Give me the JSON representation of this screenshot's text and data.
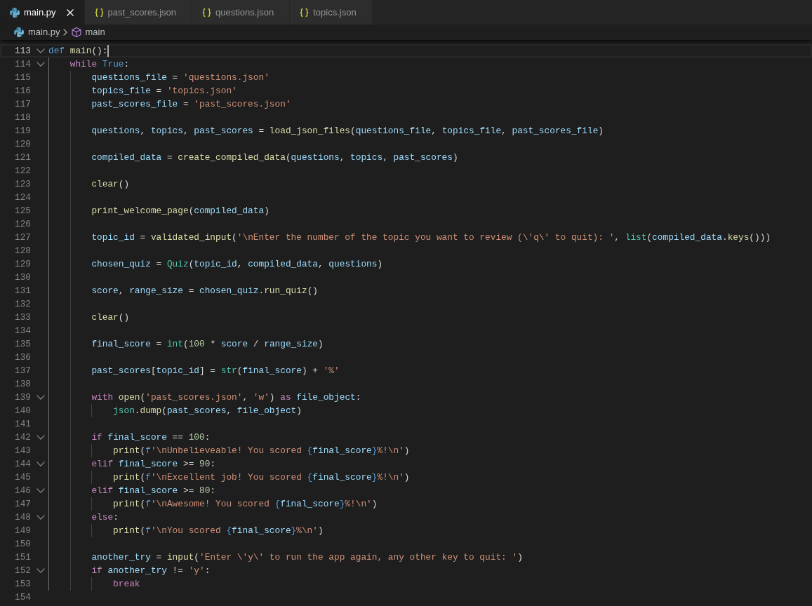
{
  "tabs": [
    {
      "label": "main.py",
      "kind": "python",
      "selected": true
    },
    {
      "label": "past_scores.json",
      "kind": "json",
      "selected": false
    },
    {
      "label": "questions.json",
      "kind": "json",
      "selected": false
    },
    {
      "label": "topics.json",
      "kind": "json",
      "selected": false
    }
  ],
  "breadcrumbs": [
    {
      "label": "main.py",
      "kind": "python"
    },
    {
      "label": "main",
      "kind": "method"
    }
  ],
  "editor": {
    "lines": [
      {
        "number": "113",
        "foldable": true,
        "active": true,
        "tokens": [
          {
            "text": "def ",
            "kind": "keyword"
          },
          {
            "text": "main",
            "kind": "function"
          },
          {
            "text": "():",
            "kind": "plain"
          }
        ]
      },
      {
        "number": "114",
        "foldable": true,
        "active": false,
        "tokens": [
          {
            "text": "    while ",
            "kind": "control"
          },
          {
            "text": "True",
            "kind": "keyword"
          },
          {
            "text": ":",
            "kind": "plain"
          }
        ]
      },
      {
        "number": "115",
        "foldable": false,
        "active": false,
        "tokens": [
          {
            "text": "        questions_file",
            "kind": "variable"
          },
          {
            "text": " = ",
            "kind": "plain"
          },
          {
            "text": "'questions.json'",
            "kind": "string"
          }
        ]
      },
      {
        "number": "116",
        "foldable": false,
        "active": false,
        "tokens": [
          {
            "text": "        topics_file",
            "kind": "variable"
          },
          {
            "text": " = ",
            "kind": "plain"
          },
          {
            "text": "'topics.json'",
            "kind": "string"
          }
        ]
      },
      {
        "number": "117",
        "foldable": false,
        "active": false,
        "tokens": [
          {
            "text": "        past_scores_file",
            "kind": "variable"
          },
          {
            "text": " = ",
            "kind": "plain"
          },
          {
            "text": "'past_scores.json'",
            "kind": "string"
          }
        ]
      },
      {
        "number": "118",
        "foldable": false,
        "active": false
      },
      {
        "number": "119",
        "foldable": false,
        "active": false,
        "tokens": [
          {
            "text": "        questions",
            "kind": "variable"
          },
          {
            "text": ", ",
            "kind": "plain"
          },
          {
            "text": "topics",
            "kind": "variable"
          },
          {
            "text": ", ",
            "kind": "plain"
          },
          {
            "text": "past_scores",
            "kind": "variable"
          },
          {
            "text": " = ",
            "kind": "plain"
          },
          {
            "text": "load_json_files",
            "kind": "function"
          },
          {
            "text": "(",
            "kind": "plain"
          },
          {
            "text": "questions_file",
            "kind": "variable"
          },
          {
            "text": ", ",
            "kind": "plain"
          },
          {
            "text": "topics_file",
            "kind": "variable"
          },
          {
            "text": ", ",
            "kind": "plain"
          },
          {
            "text": "past_scores_file",
            "kind": "variable"
          },
          {
            "text": ")",
            "kind": "plain"
          }
        ]
      },
      {
        "number": "120",
        "foldable": false,
        "active": false
      },
      {
        "number": "121",
        "foldable": false,
        "active": false,
        "tokens": [
          {
            "text": "        compiled_data",
            "kind": "variable"
          },
          {
            "text": " = ",
            "kind": "plain"
          },
          {
            "text": "create_compiled_data",
            "kind": "function"
          },
          {
            "text": "(",
            "kind": "plain"
          },
          {
            "text": "questions",
            "kind": "variable"
          },
          {
            "text": ", ",
            "kind": "plain"
          },
          {
            "text": "topics",
            "kind": "variable"
          },
          {
            "text": ", ",
            "kind": "plain"
          },
          {
            "text": "past_scores",
            "kind": "variable"
          },
          {
            "text": ")",
            "kind": "plain"
          }
        ]
      },
      {
        "number": "122",
        "foldable": false,
        "active": false
      },
      {
        "number": "123",
        "foldable": false,
        "active": false,
        "tokens": [
          {
            "text": "        clear",
            "kind": "function"
          },
          {
            "text": "()",
            "kind": "plain"
          }
        ]
      },
      {
        "number": "124",
        "foldable": false,
        "active": false
      },
      {
        "number": "125",
        "foldable": false,
        "active": false,
        "tokens": [
          {
            "text": "        print_welcome_page",
            "kind": "function"
          },
          {
            "text": "(",
            "kind": "plain"
          },
          {
            "text": "compiled_data",
            "kind": "variable"
          },
          {
            "text": ")",
            "kind": "plain"
          }
        ]
      },
      {
        "number": "126",
        "foldable": false,
        "active": false
      },
      {
        "number": "127",
        "foldable": false,
        "active": false,
        "tokens": [
          {
            "text": "        topic_id",
            "kind": "variable"
          },
          {
            "text": " = ",
            "kind": "plain"
          },
          {
            "text": "validated_input",
            "kind": "function"
          },
          {
            "text": "(",
            "kind": "plain"
          },
          {
            "text": "'\\nEnter the number of the topic you want to review (\\'q\\' to quit): '",
            "kind": "string"
          },
          {
            "text": ", ",
            "kind": "plain"
          },
          {
            "text": "list",
            "kind": "type"
          },
          {
            "text": "(",
            "kind": "plain"
          },
          {
            "text": "compiled_data",
            "kind": "variable"
          },
          {
            "text": ".",
            "kind": "plain"
          },
          {
            "text": "keys",
            "kind": "function"
          },
          {
            "text": "()))",
            "kind": "plain"
          }
        ]
      },
      {
        "number": "128",
        "foldable": false,
        "active": false
      },
      {
        "number": "129",
        "foldable": false,
        "active": false,
        "tokens": [
          {
            "text": "        chosen_quiz",
            "kind": "variable"
          },
          {
            "text": " = ",
            "kind": "plain"
          },
          {
            "text": "Quiz",
            "kind": "type"
          },
          {
            "text": "(",
            "kind": "plain"
          },
          {
            "text": "topic_id",
            "kind": "variable"
          },
          {
            "text": ", ",
            "kind": "plain"
          },
          {
            "text": "compiled_data",
            "kind": "variable"
          },
          {
            "text": ", ",
            "kind": "plain"
          },
          {
            "text": "questions",
            "kind": "variable"
          },
          {
            "text": ")",
            "kind": "plain"
          }
        ]
      },
      {
        "number": "130",
        "foldable": false,
        "active": false
      },
      {
        "number": "131",
        "foldable": false,
        "active": false,
        "tokens": [
          {
            "text": "        score",
            "kind": "variable"
          },
          {
            "text": ", ",
            "kind": "plain"
          },
          {
            "text": "range_size",
            "kind": "variable"
          },
          {
            "text": " = ",
            "kind": "plain"
          },
          {
            "text": "chosen_quiz",
            "kind": "variable"
          },
          {
            "text": ".",
            "kind": "plain"
          },
          {
            "text": "run_quiz",
            "kind": "function"
          },
          {
            "text": "()",
            "kind": "plain"
          }
        ]
      },
      {
        "number": "132",
        "foldable": false,
        "active": false
      },
      {
        "number": "133",
        "foldable": false,
        "active": false,
        "tokens": [
          {
            "text": "        clear",
            "kind": "function"
          },
          {
            "text": "()",
            "kind": "plain"
          }
        ]
      },
      {
        "number": "134",
        "foldable": false,
        "active": false
      },
      {
        "number": "135",
        "foldable": false,
        "active": false,
        "tokens": [
          {
            "text": "        final_score",
            "kind": "variable"
          },
          {
            "text": " = ",
            "kind": "plain"
          },
          {
            "text": "int",
            "kind": "type"
          },
          {
            "text": "(",
            "kind": "plain"
          },
          {
            "text": "100",
            "kind": "number"
          },
          {
            "text": " * ",
            "kind": "plain"
          },
          {
            "text": "score",
            "kind": "variable"
          },
          {
            "text": " / ",
            "kind": "plain"
          },
          {
            "text": "range_size",
            "kind": "variable"
          },
          {
            "text": ")",
            "kind": "plain"
          }
        ]
      },
      {
        "number": "136",
        "foldable": false,
        "active": false
      },
      {
        "number": "137",
        "foldable": false,
        "active": false,
        "tokens": [
          {
            "text": "        past_scores",
            "kind": "variable"
          },
          {
            "text": "[",
            "kind": "plain"
          },
          {
            "text": "topic_id",
            "kind": "variable"
          },
          {
            "text": "] = ",
            "kind": "plain"
          },
          {
            "text": "str",
            "kind": "type"
          },
          {
            "text": "(",
            "kind": "plain"
          },
          {
            "text": "final_score",
            "kind": "variable"
          },
          {
            "text": ") + ",
            "kind": "plain"
          },
          {
            "text": "'%'",
            "kind": "string"
          }
        ]
      },
      {
        "number": "138",
        "foldable": false,
        "active": false
      },
      {
        "number": "139",
        "foldable": true,
        "active": false,
        "tokens": [
          {
            "text": "        with ",
            "kind": "control"
          },
          {
            "text": "open",
            "kind": "function"
          },
          {
            "text": "(",
            "kind": "plain"
          },
          {
            "text": "'past_scores.json'",
            "kind": "string"
          },
          {
            "text": ", ",
            "kind": "plain"
          },
          {
            "text": "'w'",
            "kind": "string"
          },
          {
            "text": ") ",
            "kind": "plain"
          },
          {
            "text": "as ",
            "kind": "control"
          },
          {
            "text": "file_object",
            "kind": "variable"
          },
          {
            "text": ":",
            "kind": "plain"
          }
        ]
      },
      {
        "number": "140",
        "foldable": false,
        "active": false,
        "tokens": [
          {
            "text": "            json",
            "kind": "type"
          },
          {
            "text": ".",
            "kind": "plain"
          },
          {
            "text": "dump",
            "kind": "function"
          },
          {
            "text": "(",
            "kind": "plain"
          },
          {
            "text": "past_scores",
            "kind": "variable"
          },
          {
            "text": ", ",
            "kind": "plain"
          },
          {
            "text": "file_object",
            "kind": "variable"
          },
          {
            "text": ")",
            "kind": "plain"
          }
        ]
      },
      {
        "number": "141",
        "foldable": false,
        "active": false
      },
      {
        "number": "142",
        "foldable": true,
        "active": false,
        "tokens": [
          {
            "text": "        if ",
            "kind": "control"
          },
          {
            "text": "final_score",
            "kind": "variable"
          },
          {
            "text": " == ",
            "kind": "plain"
          },
          {
            "text": "100",
            "kind": "number"
          },
          {
            "text": ":",
            "kind": "plain"
          }
        ]
      },
      {
        "number": "143",
        "foldable": false,
        "active": false,
        "tokens": [
          {
            "text": "            print",
            "kind": "function"
          },
          {
            "text": "(",
            "kind": "plain"
          },
          {
            "text": "f",
            "kind": "keyword"
          },
          {
            "text": "'\\nUnbelieveable! You scored ",
            "kind": "string"
          },
          {
            "text": "{",
            "kind": "keyword"
          },
          {
            "text": "final_score",
            "kind": "variable"
          },
          {
            "text": "}",
            "kind": "keyword"
          },
          {
            "text": "%!\\n'",
            "kind": "string"
          },
          {
            "text": ")",
            "kind": "plain"
          }
        ]
      },
      {
        "number": "144",
        "foldable": true,
        "active": false,
        "tokens": [
          {
            "text": "        elif ",
            "kind": "control"
          },
          {
            "text": "final_score",
            "kind": "variable"
          },
          {
            "text": " >= ",
            "kind": "plain"
          },
          {
            "text": "90",
            "kind": "number"
          },
          {
            "text": ":",
            "kind": "plain"
          }
        ]
      },
      {
        "number": "145",
        "foldable": false,
        "active": false,
        "tokens": [
          {
            "text": "            print",
            "kind": "function"
          },
          {
            "text": "(",
            "kind": "plain"
          },
          {
            "text": "f",
            "kind": "keyword"
          },
          {
            "text": "'\\nExcellent job! You scored ",
            "kind": "string"
          },
          {
            "text": "{",
            "kind": "keyword"
          },
          {
            "text": "final_score",
            "kind": "variable"
          },
          {
            "text": "}",
            "kind": "keyword"
          },
          {
            "text": "%!\\n'",
            "kind": "string"
          },
          {
            "text": ")",
            "kind": "plain"
          }
        ]
      },
      {
        "number": "146",
        "foldable": true,
        "active": false,
        "tokens": [
          {
            "text": "        elif ",
            "kind": "control"
          },
          {
            "text": "final_score",
            "kind": "variable"
          },
          {
            "text": " >= ",
            "kind": "plain"
          },
          {
            "text": "80",
            "kind": "number"
          },
          {
            "text": ":",
            "kind": "plain"
          }
        ]
      },
      {
        "number": "147",
        "foldable": false,
        "active": false,
        "tokens": [
          {
            "text": "            print",
            "kind": "function"
          },
          {
            "text": "(",
            "kind": "plain"
          },
          {
            "text": "f",
            "kind": "keyword"
          },
          {
            "text": "'\\nAwesome! You scored ",
            "kind": "string"
          },
          {
            "text": "{",
            "kind": "keyword"
          },
          {
            "text": "final_score",
            "kind": "variable"
          },
          {
            "text": "}",
            "kind": "keyword"
          },
          {
            "text": "%!\\n'",
            "kind": "string"
          },
          {
            "text": ")",
            "kind": "plain"
          }
        ]
      },
      {
        "number": "148",
        "foldable": true,
        "active": false,
        "tokens": [
          {
            "text": "        else",
            "kind": "control"
          },
          {
            "text": ":",
            "kind": "plain"
          }
        ]
      },
      {
        "number": "149",
        "foldable": false,
        "active": false,
        "tokens": [
          {
            "text": "            print",
            "kind": "function"
          },
          {
            "text": "(",
            "kind": "plain"
          },
          {
            "text": "f",
            "kind": "keyword"
          },
          {
            "text": "'\\nYou scored ",
            "kind": "string"
          },
          {
            "text": "{",
            "kind": "keyword"
          },
          {
            "text": "final_score",
            "kind": "variable"
          },
          {
            "text": "}",
            "kind": "keyword"
          },
          {
            "text": "%\\n'",
            "kind": "string"
          },
          {
            "text": ")",
            "kind": "plain"
          }
        ]
      },
      {
        "number": "150",
        "foldable": false,
        "active": false
      },
      {
        "number": "151",
        "foldable": false,
        "active": false,
        "tokens": [
          {
            "text": "        another_try",
            "kind": "variable"
          },
          {
            "text": " = ",
            "kind": "plain"
          },
          {
            "text": "input",
            "kind": "function"
          },
          {
            "text": "(",
            "kind": "plain"
          },
          {
            "text": "'Enter \\'y\\' to run the app again, any other key to quit: '",
            "kind": "string"
          },
          {
            "text": ")",
            "kind": "plain"
          }
        ]
      },
      {
        "number": "152",
        "foldable": true,
        "active": false,
        "tokens": [
          {
            "text": "        if ",
            "kind": "control"
          },
          {
            "text": "another_try",
            "kind": "variable"
          },
          {
            "text": " != ",
            "kind": "plain"
          },
          {
            "text": "'y'",
            "kind": "string"
          },
          {
            "text": ":",
            "kind": "plain"
          }
        ]
      },
      {
        "number": "153",
        "foldable": false,
        "active": false,
        "tokens": [
          {
            "text": "            break",
            "kind": "control"
          }
        ]
      },
      {
        "number": "154",
        "foldable": false,
        "active": false
      }
    ]
  }
}
